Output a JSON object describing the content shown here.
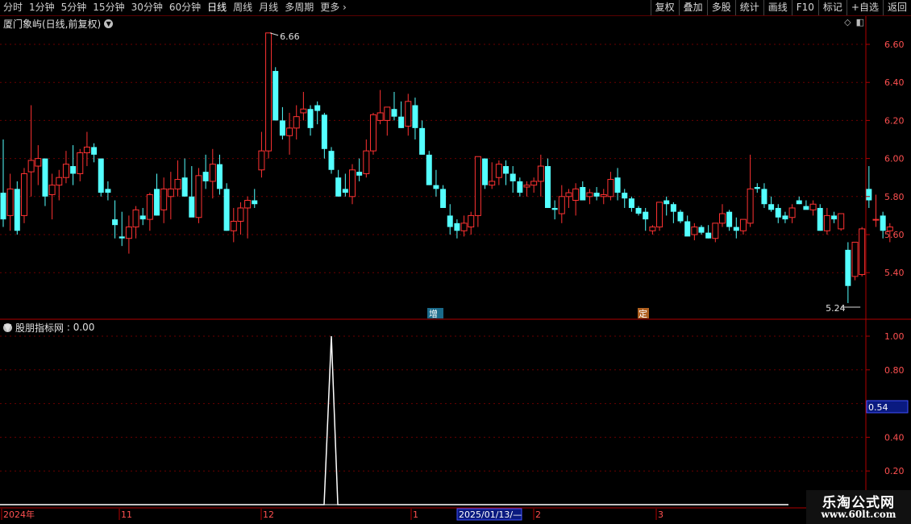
{
  "toolbar": {
    "periods": [
      "分时",
      "1分钟",
      "5分钟",
      "15分钟",
      "30分钟",
      "60分钟",
      "日线",
      "周线",
      "月线",
      "多周期",
      "更多"
    ],
    "active_period": "日线",
    "actions": [
      "复权",
      "叠加",
      "多股",
      "统计",
      "画线",
      "F10",
      "标记",
      "+自选",
      "返回"
    ]
  },
  "main_panel": {
    "title": "厦门象屿(日线,前复权)",
    "y_ticks": [
      "6.60",
      "6.40",
      "6.20",
      "6.00",
      "5.80",
      "5.60",
      "5.40"
    ],
    "high_label": "6.66",
    "low_label": "5.24",
    "markers": [
      {
        "text": "增",
        "bg": "#1a6a8a"
      },
      {
        "text": "定",
        "bg": "#b06020"
      }
    ]
  },
  "indicator_panel": {
    "title": "股朋指标网",
    "value": "0.00",
    "y_ticks": [
      "1.00",
      "0.80",
      "0.40",
      "0.20"
    ],
    "current_value": "0.54"
  },
  "x_axis": {
    "labels": [
      "2024年",
      "11",
      "12",
      "1",
      "2",
      "3"
    ],
    "cursor_date": "2025/01/13/—"
  },
  "colors": {
    "up": "#ff3232",
    "down": "#54ffff",
    "grid": "#6a0000",
    "axis": "#b00000",
    "label": "#ff5050"
  },
  "watermark": {
    "line1": "乐淘公式网",
    "line2": "www.60lt.com"
  },
  "chart_data": {
    "type": "candlestick",
    "series": [
      {
        "values": [
          [
            5.82,
            6.1,
            5.64,
            5.68
          ],
          [
            5.7,
            5.92,
            5.62,
            5.84
          ],
          [
            5.84,
            5.88,
            5.6,
            5.62
          ],
          [
            5.7,
            5.95,
            5.66,
            5.92
          ],
          [
            5.93,
            6.28,
            5.8,
            5.99
          ],
          [
            5.96,
            6.07,
            5.86,
            6.0
          ],
          [
            6.0,
            6.0,
            5.75,
            5.8
          ],
          [
            5.81,
            5.92,
            5.68,
            5.86
          ],
          [
            5.86,
            5.94,
            5.78,
            5.9
          ],
          [
            5.9,
            6.04,
            5.87,
            5.97
          ],
          [
            5.96,
            6.07,
            5.86,
            5.92
          ],
          [
            5.92,
            6.05,
            5.88,
            6.03
          ],
          [
            6.03,
            6.14,
            5.96,
            6.06
          ],
          [
            6.06,
            6.08,
            5.98,
            6.02
          ],
          [
            6.0,
            6.0,
            5.8,
            5.82
          ],
          [
            5.84,
            5.88,
            5.78,
            5.82
          ],
          [
            5.68,
            5.78,
            5.58,
            5.65
          ],
          [
            5.59,
            5.72,
            5.54,
            5.58
          ],
          [
            5.58,
            5.7,
            5.5,
            5.64
          ],
          [
            5.64,
            5.75,
            5.58,
            5.73
          ],
          [
            5.7,
            5.74,
            5.65,
            5.68
          ],
          [
            5.68,
            5.82,
            5.62,
            5.81
          ],
          [
            5.84,
            5.92,
            5.7,
            5.7
          ],
          [
            5.73,
            5.9,
            5.66,
            5.84
          ],
          [
            5.8,
            5.93,
            5.68,
            5.84
          ],
          [
            5.84,
            5.99,
            5.8,
            5.89
          ],
          [
            5.9,
            6.0,
            5.8,
            5.8
          ],
          [
            5.8,
            5.96,
            5.74,
            5.69
          ],
          [
            5.69,
            5.95,
            5.66,
            5.91
          ],
          [
            5.93,
            6.02,
            5.84,
            5.88
          ],
          [
            5.88,
            6.05,
            5.79,
            5.97
          ],
          [
            5.97,
            6.02,
            5.81,
            5.84
          ],
          [
            5.84,
            5.87,
            5.62,
            5.62
          ],
          [
            5.62,
            5.74,
            5.56,
            5.67
          ],
          [
            5.67,
            5.77,
            5.6,
            5.74
          ],
          [
            5.74,
            5.8,
            5.58,
            5.78
          ],
          [
            5.78,
            5.84,
            5.74,
            5.76
          ],
          [
            5.94,
            6.14,
            5.9,
            6.04
          ],
          [
            6.04,
            6.66,
            6.0,
            6.66
          ],
          [
            6.46,
            6.48,
            6.2,
            6.2
          ],
          [
            6.2,
            6.27,
            6.1,
            6.12
          ],
          [
            6.12,
            6.24,
            6.02,
            6.16
          ],
          [
            6.16,
            6.28,
            6.1,
            6.22
          ],
          [
            6.24,
            6.35,
            6.2,
            6.26
          ],
          [
            6.26,
            6.28,
            6.12,
            6.16
          ],
          [
            6.28,
            6.3,
            6.18,
            6.25
          ],
          [
            6.23,
            6.24,
            6.0,
            6.05
          ],
          [
            6.04,
            6.06,
            5.92,
            5.94
          ],
          [
            5.9,
            5.94,
            5.8,
            5.8
          ],
          [
            5.84,
            5.92,
            5.8,
            5.82
          ],
          [
            5.8,
            5.97,
            5.76,
            5.94
          ],
          [
            5.93,
            6.0,
            5.88,
            5.91
          ],
          [
            5.92,
            6.1,
            5.9,
            6.04
          ],
          [
            6.04,
            6.24,
            6.02,
            6.23
          ],
          [
            6.2,
            6.36,
            6.18,
            6.24
          ],
          [
            6.2,
            6.26,
            6.12,
            6.27
          ],
          [
            6.26,
            6.35,
            6.2,
            6.22
          ],
          [
            6.22,
            6.3,
            6.16,
            6.16
          ],
          [
            6.17,
            6.34,
            6.12,
            6.3
          ],
          [
            6.28,
            6.32,
            6.1,
            6.16
          ],
          [
            6.16,
            6.2,
            6.02,
            6.02
          ],
          [
            6.02,
            6.04,
            5.86,
            5.86
          ],
          [
            5.86,
            5.94,
            5.8,
            5.84
          ],
          [
            5.84,
            5.86,
            5.74,
            5.74
          ],
          [
            5.7,
            5.76,
            5.6,
            5.64
          ],
          [
            5.66,
            5.68,
            5.58,
            5.62
          ],
          [
            5.62,
            5.7,
            5.59,
            5.66
          ],
          [
            5.64,
            5.72,
            5.6,
            5.7
          ],
          [
            5.7,
            6.01,
            5.64,
            6.01
          ],
          [
            6.0,
            6.0,
            5.84,
            5.86
          ],
          [
            5.86,
            5.98,
            5.84,
            5.88
          ],
          [
            5.9,
            5.99,
            5.86,
            5.97
          ],
          [
            5.96,
            5.99,
            5.86,
            5.92
          ],
          [
            5.92,
            5.96,
            5.82,
            5.88
          ],
          [
            5.88,
            5.9,
            5.8,
            5.82
          ],
          [
            5.85,
            5.88,
            5.8,
            5.86
          ],
          [
            5.86,
            5.9,
            5.82,
            5.88
          ],
          [
            5.88,
            6.02,
            5.8,
            5.96
          ],
          [
            5.96,
            6.0,
            5.74,
            5.74
          ],
          [
            5.74,
            5.78,
            5.68,
            5.73
          ],
          [
            5.71,
            5.86,
            5.66,
            5.8
          ],
          [
            5.8,
            5.84,
            5.74,
            5.82
          ],
          [
            5.78,
            5.87,
            5.7,
            5.84
          ],
          [
            5.85,
            5.88,
            5.78,
            5.78
          ],
          [
            5.8,
            5.84,
            5.76,
            5.82
          ],
          [
            5.82,
            5.85,
            5.78,
            5.8
          ],
          [
            5.8,
            5.84,
            5.76,
            5.81
          ],
          [
            5.8,
            5.93,
            5.78,
            5.89
          ],
          [
            5.9,
            5.95,
            5.78,
            5.82
          ],
          [
            5.82,
            5.84,
            5.74,
            5.79
          ],
          [
            5.79,
            5.8,
            5.72,
            5.74
          ],
          [
            5.74,
            5.75,
            5.7,
            5.71
          ],
          [
            5.72,
            5.74,
            5.62,
            5.68
          ],
          [
            5.62,
            5.65,
            5.6,
            5.64
          ],
          [
            5.64,
            5.77,
            5.62,
            5.77
          ],
          [
            5.78,
            5.8,
            5.7,
            5.76
          ],
          [
            5.76,
            5.77,
            5.66,
            5.72
          ],
          [
            5.72,
            5.73,
            5.66,
            5.67
          ],
          [
            5.67,
            5.7,
            5.6,
            5.59
          ],
          [
            5.6,
            5.66,
            5.57,
            5.64
          ],
          [
            5.64,
            5.65,
            5.6,
            5.61
          ],
          [
            5.61,
            5.65,
            5.58,
            5.58
          ],
          [
            5.58,
            5.64,
            5.56,
            5.66
          ],
          [
            5.66,
            5.76,
            5.64,
            5.71
          ],
          [
            5.72,
            5.73,
            5.62,
            5.64
          ],
          [
            5.64,
            5.69,
            5.58,
            5.62
          ],
          [
            5.62,
            5.68,
            5.6,
            5.68
          ],
          [
            5.66,
            6.02,
            5.64,
            5.84
          ],
          [
            5.85,
            5.87,
            5.82,
            5.84
          ],
          [
            5.84,
            5.87,
            5.74,
            5.76
          ],
          [
            5.76,
            5.8,
            5.72,
            5.73
          ],
          [
            5.74,
            5.76,
            5.66,
            5.69
          ],
          [
            5.7,
            5.72,
            5.66,
            5.68
          ],
          [
            5.69,
            5.76,
            5.66,
            5.74
          ],
          [
            5.78,
            5.8,
            5.76,
            5.76
          ],
          [
            5.75,
            5.78,
            5.74,
            5.73
          ],
          [
            5.73,
            5.78,
            5.7,
            5.76
          ],
          [
            5.74,
            5.76,
            5.62,
            5.62
          ],
          [
            5.62,
            5.74,
            5.6,
            5.7
          ],
          [
            5.7,
            5.72,
            5.66,
            5.68
          ],
          [
            5.63,
            5.71,
            5.62,
            5.71
          ],
          [
            5.52,
            5.56,
            5.24,
            5.33
          ],
          [
            5.38,
            5.56,
            5.36,
            5.56
          ],
          [
            5.39,
            5.64,
            5.38,
            5.63
          ],
          [
            5.84,
            5.96,
            5.74,
            5.78
          ],
          [
            5.68,
            5.81,
            5.64,
            5.68
          ],
          [
            5.7,
            5.72,
            5.58,
            5.62
          ],
          [
            5.62,
            5.66,
            5.56,
            5.64
          ]
        ]
      }
    ],
    "indicator": {
      "spike_index": 47,
      "spike_value": 1.0,
      "baseline": 0.0
    },
    "y_range": [
      5.24,
      6.66
    ],
    "x_tick_labels": [
      "2024年",
      "11",
      "12",
      "1",
      "2",
      "3"
    ]
  }
}
